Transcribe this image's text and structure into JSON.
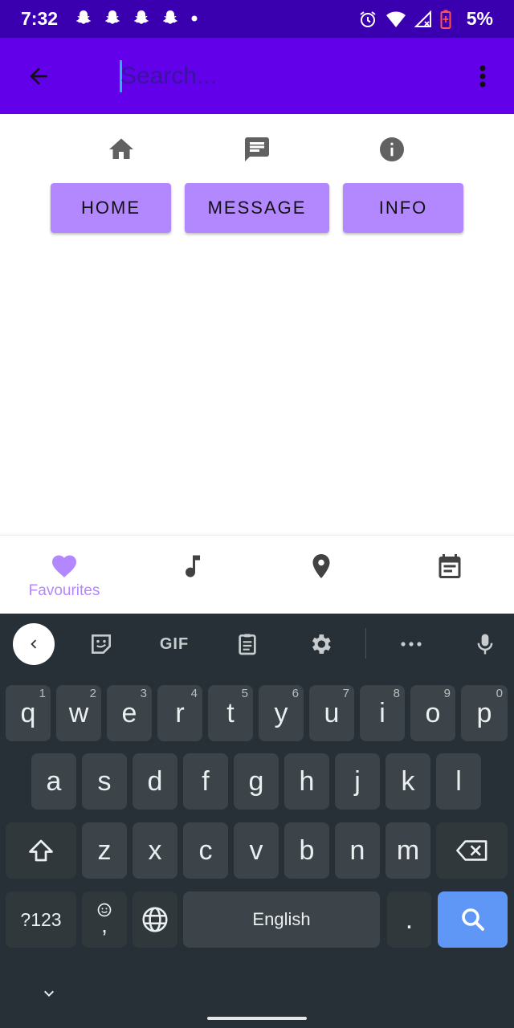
{
  "status_bar": {
    "time": "7:32",
    "battery": "5%",
    "left_icons": [
      "snapchat-icon",
      "snapchat-icon",
      "snapchat-icon",
      "snapchat-icon",
      "dot-icon"
    ],
    "right_icons": [
      "alarm-icon",
      "wifi-icon",
      "cellular-icon",
      "battery-icon"
    ]
  },
  "app_bar": {
    "color": "#6200ea",
    "search_placeholder": "Search..."
  },
  "nav_buttons": [
    {
      "label": "HOME",
      "icon": "home-icon"
    },
    {
      "label": "MESSAGE",
      "icon": "message-icon"
    },
    {
      "label": "INFO",
      "icon": "info-icon"
    }
  ],
  "bottom_nav": {
    "items": [
      {
        "label": "Favourites",
        "icon": "heart-icon",
        "active": true
      },
      {
        "label": "",
        "icon": "music-note-icon",
        "active": false
      },
      {
        "label": "",
        "icon": "location-pin-icon",
        "active": false
      },
      {
        "label": "",
        "icon": "calendar-icon",
        "active": false
      }
    ],
    "accent": "#b388ff"
  },
  "keyboard": {
    "toolbar": {
      "gif_label": "GIF",
      "items": [
        "back-icon",
        "sticker-icon",
        "gif-icon",
        "clipboard-icon",
        "settings-icon",
        "more-icon",
        "mic-icon"
      ]
    },
    "row1": [
      {
        "k": "q",
        "h": "1"
      },
      {
        "k": "w",
        "h": "2"
      },
      {
        "k": "e",
        "h": "3"
      },
      {
        "k": "r",
        "h": "4"
      },
      {
        "k": "t",
        "h": "5"
      },
      {
        "k": "y",
        "h": "6"
      },
      {
        "k": "u",
        "h": "7"
      },
      {
        "k": "i",
        "h": "8"
      },
      {
        "k": "o",
        "h": "9"
      },
      {
        "k": "p",
        "h": "0"
      }
    ],
    "row2": [
      "a",
      "s",
      "d",
      "f",
      "g",
      "h",
      "j",
      "k",
      "l"
    ],
    "row3": [
      "z",
      "x",
      "c",
      "v",
      "b",
      "n",
      "m"
    ],
    "symbols_label": "?123",
    "comma_label": ",",
    "space_label": "English",
    "period_label": ".",
    "search_key_color": "#5e97f6"
  }
}
